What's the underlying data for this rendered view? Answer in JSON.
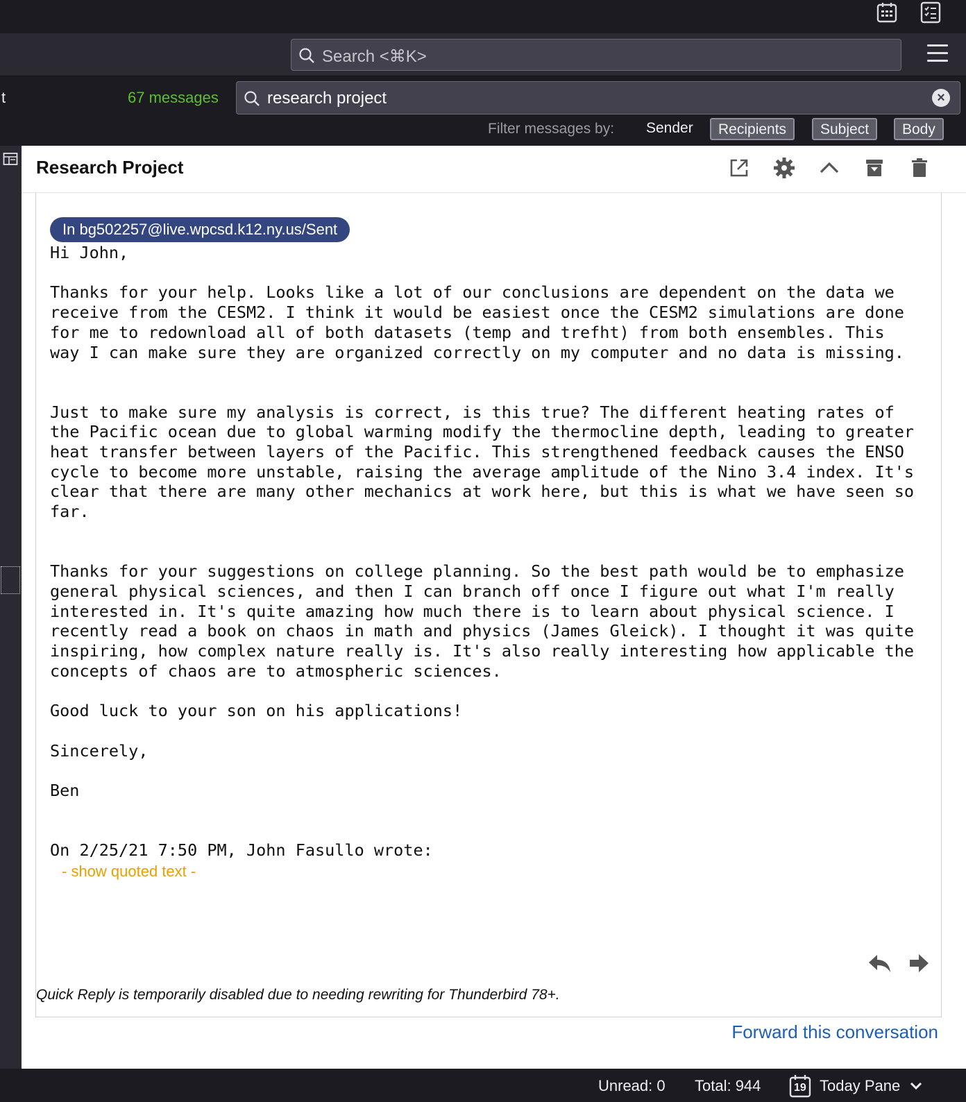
{
  "titlebar": {
    "icons": [
      "calendar-icon",
      "tasks-icon"
    ]
  },
  "toolbar": {
    "search_placeholder": "Search <⌘K>"
  },
  "filterbar": {
    "left_stub": "t",
    "message_count": "67 messages",
    "query": "research project",
    "filter_label": "Filter messages by:",
    "filters": [
      {
        "label": "Sender",
        "active": false
      },
      {
        "label": "Recipients",
        "active": true
      },
      {
        "label": "Subject",
        "active": true
      },
      {
        "label": "Body",
        "active": true
      }
    ]
  },
  "message": {
    "subject": "Research Project",
    "folder": "In bg502257@live.wpcsd.k12.ny.us/Sent",
    "body": "Hi John,\n\nThanks for your help. Looks like a lot of our conclusions are dependent on the data we\nreceive from the CESM2. I think it would be easiest once the CESM2 simulations are done\nfor me to redownload all of both datasets (temp and trefht) from both ensembles. This\nway I can make sure they are organized correctly on my computer and no data is missing.\n\n\nJust to make sure my analysis is correct, is this true? The different heating rates of\nthe Pacific ocean due to global warming modify the thermocline depth, leading to greater\nheat transfer between layers of the Pacific. This strengthened feedback causes the ENSO\ncycle to become more unstable, raising the average amplitude of the Nino 3.4 index. It's\nclear that there are many other mechanics at work here, but this is what we have seen so\nfar.\n\n\nThanks for your suggestions on college planning. So the best path would be to emphasize\ngeneral physical sciences, and then I can branch off once I figure out what I'm really\ninterested in. It's quite amazing how much there is to learn about physical science. I\nrecently read a book on chaos in math and physics (James Gleick). I thought it was quite\ninspiring, how complex nature really is. It's also really interesting how applicable the\nconcepts of chaos are to atmospheric sciences.\n\nGood luck to your son on his applications!\n\nSincerely,\n\nBen\n\n\nOn 2/25/21 7:50 PM, John Fasullo wrote:",
    "show_quoted": "- show quoted text -",
    "quick_reply_note": "Quick Reply is temporarily disabled due to needing rewriting for Thunderbird 78+.",
    "forward_conversation": "Forward this conversation"
  },
  "colors": {
    "accent_link": "#1c5fb8",
    "message_count": "#5cbf2a",
    "quoted_toggle": "#e8a000",
    "folder_badge": "#34467f",
    "avatar": "#7c3aed"
  },
  "statusbar": {
    "unread": "Unread: 0",
    "total": "Total: 944",
    "today_day": "19",
    "today_pane": "Today Pane"
  }
}
